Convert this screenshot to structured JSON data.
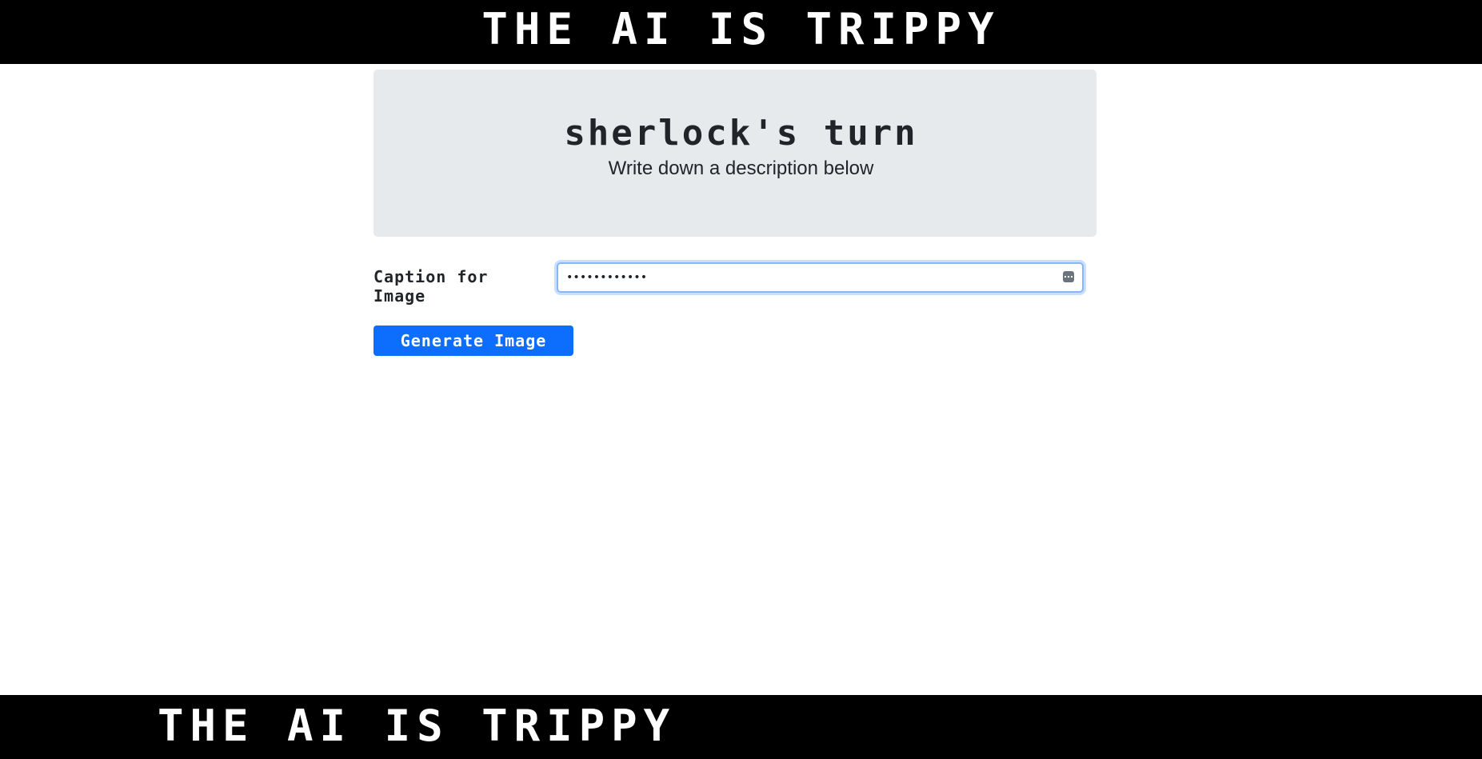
{
  "header": {
    "title": "THE AI IS TRIPPY"
  },
  "turn": {
    "title": "sherlock's turn",
    "subtitle": "Write down a description below"
  },
  "form": {
    "caption_label": "Caption for Image",
    "caption_value": "••••••••••••",
    "generate_label": "Generate Image"
  },
  "footer": {
    "title": "THE AI IS TRIPPY"
  },
  "colors": {
    "bar_background": "#000000",
    "panel_background": "#e7eaed",
    "primary_button": "#0d6efd",
    "focus_border": "#86b7fe"
  },
  "icons": {
    "password_manager": "key-icon"
  }
}
